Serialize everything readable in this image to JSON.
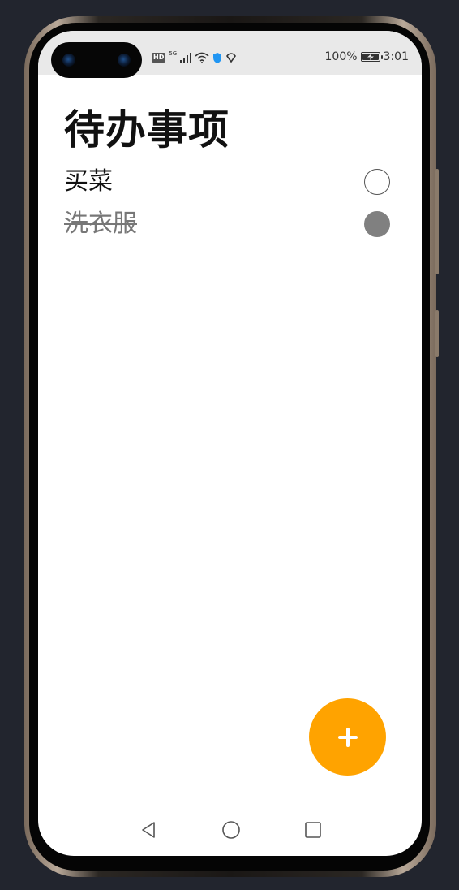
{
  "status_bar": {
    "hd_label": "HD",
    "network_label": "5G",
    "battery_percent": "100%",
    "time": "3:01"
  },
  "page": {
    "title": "待办事项"
  },
  "todos": [
    {
      "label": "买菜",
      "completed": false
    },
    {
      "label": "洗衣服",
      "completed": true
    }
  ],
  "fab": {
    "icon": "plus-icon",
    "color": "#ffa300"
  },
  "nav": {
    "back_icon": "back-triangle-icon",
    "home_icon": "home-circle-icon",
    "recents_icon": "recents-square-icon"
  },
  "colors": {
    "accent": "#ffa300",
    "checked": "#808080",
    "status_bar_bg": "#e9e9e9"
  }
}
